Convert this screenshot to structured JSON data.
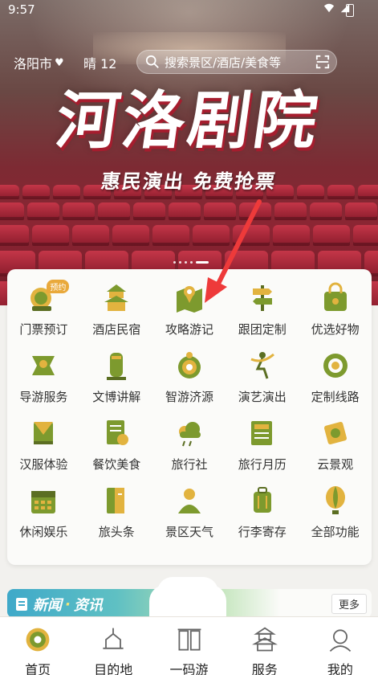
{
  "status_bar": {
    "time": "9:57"
  },
  "header": {
    "city": "洛阳市",
    "weather": "晴 12",
    "search_placeholder": "搜索景区/酒店/美食等"
  },
  "banner": {
    "title": "河洛剧院",
    "subtitle": "惠民演出 免费抢票"
  },
  "functions": [
    {
      "label": "门票预订",
      "icon": "lion-icon",
      "badge": "预约"
    },
    {
      "label": "酒店民宿",
      "icon": "pagoda-icon"
    },
    {
      "label": "攻略游记",
      "icon": "map-pin-icon"
    },
    {
      "label": "跟团定制",
      "icon": "signpost-icon"
    },
    {
      "label": "优选好物",
      "icon": "shopping-bag-icon"
    },
    {
      "label": "导游服务",
      "icon": "guide-flag-icon"
    },
    {
      "label": "文博讲解",
      "icon": "artifact-icon"
    },
    {
      "label": "智游济源",
      "icon": "peony-icon"
    },
    {
      "label": "演艺演出",
      "icon": "dancer-icon"
    },
    {
      "label": "定制线路",
      "icon": "route-ring-icon"
    },
    {
      "label": "汉服体验",
      "icon": "hanfu-icon"
    },
    {
      "label": "餐饮美食",
      "icon": "menu-icon"
    },
    {
      "label": "旅行社",
      "icon": "cloud-icon"
    },
    {
      "label": "旅行月历",
      "icon": "news-icon"
    },
    {
      "label": "云景观",
      "icon": "scroll-icon"
    },
    {
      "label": "休闲娱乐",
      "icon": "calendar-icon"
    },
    {
      "label": "旅头条",
      "icon": "book-icon"
    },
    {
      "label": "景区天气",
      "icon": "person-icon"
    },
    {
      "label": "行李寄存",
      "icon": "luggage-icon"
    },
    {
      "label": "全部功能",
      "icon": "balloon-icon"
    }
  ],
  "news": {
    "title_a": "新闻",
    "separator": "·",
    "title_b": "资讯",
    "more_label": "更多"
  },
  "nav": [
    {
      "label": "首页",
      "icon": "home-peony-icon"
    },
    {
      "label": "目的地",
      "icon": "destination-icon"
    },
    {
      "label": "一码游",
      "icon": "qr-gate-icon"
    },
    {
      "label": "服务",
      "icon": "service-pagoda-icon"
    },
    {
      "label": "我的",
      "icon": "profile-icon"
    }
  ],
  "colors": {
    "accent_green": "#7d9a2e",
    "accent_gold": "#e2b33f",
    "banner_red": "#a61d2e"
  }
}
